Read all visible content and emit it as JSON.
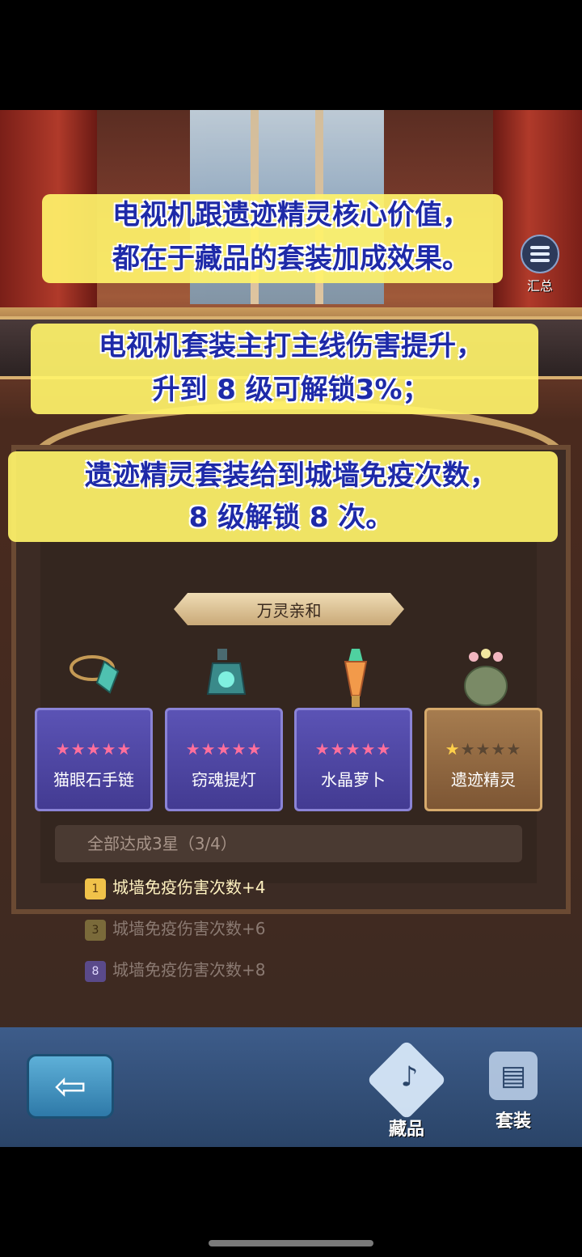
{
  "captions": {
    "line1": "电视机跟遗迹精灵核心价值，",
    "line2": "都在于藏品的套装加成效果。",
    "line3": "电视机套装主打主线伤害提升，",
    "line4": "升到 8 级可解锁3%；",
    "line5": "遗迹精灵套装给到城墙免疫次数，",
    "line6": "8 级解锁 8 次。"
  },
  "summary_button": {
    "label": "汇总",
    "icon": "list-icon"
  },
  "set_title": "万灵亲和",
  "items": [
    {
      "name": "猫眼石手链",
      "stars_filled": 5,
      "stars_total": 5,
      "style": "purple"
    },
    {
      "name": "窃魂提灯",
      "stars_filled": 5,
      "stars_total": 5,
      "style": "purple"
    },
    {
      "name": "水晶萝卜",
      "stars_filled": 5,
      "stars_total": 5,
      "style": "purple"
    },
    {
      "name": "遗迹精灵",
      "stars_filled": 1,
      "stars_total": 5,
      "style": "gold"
    }
  ],
  "goal_text": "全部达成3星（3/4）",
  "bonuses": [
    {
      "level": "1",
      "text": "城墙免疫伤害次数+4",
      "active": true
    },
    {
      "level": "3",
      "text": "城墙免疫伤害次数+6",
      "active": false
    },
    {
      "level": "8",
      "text": "城墙免疫伤害次数+8",
      "active": false
    }
  ],
  "nav": {
    "back_icon": "arrow-left-icon",
    "tab_collection": "藏品",
    "tab_set": "套装"
  }
}
